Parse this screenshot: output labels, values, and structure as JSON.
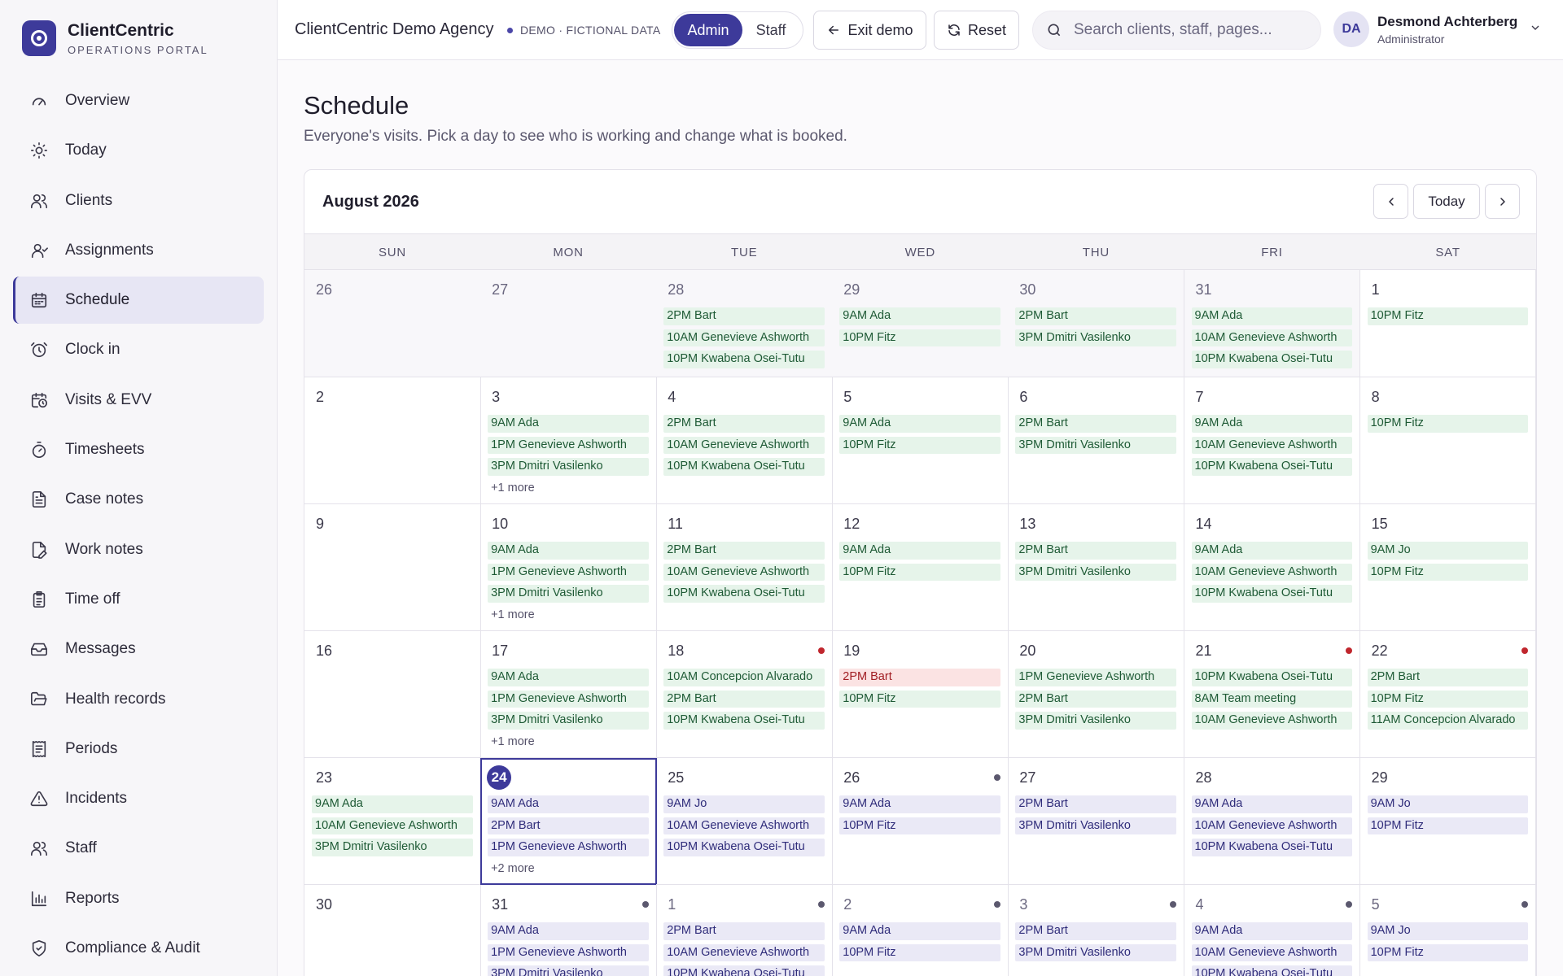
{
  "brand": {
    "name": "ClientCentric",
    "subtitle": "OPERATIONS PORTAL"
  },
  "sidebar": {
    "items": [
      {
        "label": "Overview",
        "icon": "gauge-icon",
        "active": false
      },
      {
        "label": "Today",
        "icon": "sun-icon",
        "active": false
      },
      {
        "label": "Clients",
        "icon": "users-icon",
        "active": false
      },
      {
        "label": "Assignments",
        "icon": "user-check-icon",
        "active": false
      },
      {
        "label": "Schedule",
        "icon": "calendar-icon",
        "active": true
      },
      {
        "label": "Clock in",
        "icon": "alarm-clock-icon",
        "active": false
      },
      {
        "label": "Visits & EVV",
        "icon": "calendar-clock-icon",
        "active": false
      },
      {
        "label": "Timesheets",
        "icon": "stopwatch-icon",
        "active": false
      },
      {
        "label": "Case notes",
        "icon": "file-text-icon",
        "active": false
      },
      {
        "label": "Work notes",
        "icon": "file-edit-icon",
        "active": false
      },
      {
        "label": "Time off",
        "icon": "clipboard-icon",
        "active": false
      },
      {
        "label": "Messages",
        "icon": "inbox-icon",
        "active": false
      },
      {
        "label": "Health records",
        "icon": "folder-open-icon",
        "active": false
      },
      {
        "label": "Periods",
        "icon": "receipt-icon",
        "active": false
      },
      {
        "label": "Incidents",
        "icon": "alert-triangle-icon",
        "active": false
      },
      {
        "label": "Staff",
        "icon": "users-icon",
        "active": false
      },
      {
        "label": "Reports",
        "icon": "bar-chart-icon",
        "active": false
      },
      {
        "label": "Compliance & Audit",
        "icon": "shield-check-icon",
        "active": false
      }
    ]
  },
  "topbar": {
    "agency": "ClientCentric Demo Agency",
    "demo_tag": "DEMO · FICTIONAL DATA",
    "role_admin": "Admin",
    "role_staff": "Staff",
    "exit_label": "Exit demo",
    "reset_label": "Reset",
    "search_placeholder": "Search clients, staff, pages...",
    "user_initials": "DA",
    "user_name": "Desmond Achterberg",
    "user_role": "Administrator"
  },
  "page": {
    "title": "Schedule",
    "subtitle": "Everyone's visits. Pick a day to see who is working and change what is booked."
  },
  "calendar": {
    "month": "August 2026",
    "today_label": "Today",
    "weekdays": [
      "SUN",
      "MON",
      "TUE",
      "WED",
      "THU",
      "FRI",
      "SAT"
    ],
    "weeks": [
      [
        {
          "day": "26",
          "prev": true,
          "events": []
        },
        {
          "day": "27",
          "prev": true,
          "events": []
        },
        {
          "day": "28",
          "prev": true,
          "events": [
            {
              "t": "2PM Bart",
              "c": "green"
            },
            {
              "t": "10AM Genevieve Ashworth",
              "c": "green"
            },
            {
              "t": "10PM Kwabena Osei-Tutu",
              "c": "green"
            }
          ]
        },
        {
          "day": "29",
          "prev": true,
          "events": [
            {
              "t": "9AM Ada",
              "c": "green"
            },
            {
              "t": "10PM Fitz",
              "c": "green"
            }
          ]
        },
        {
          "day": "30",
          "prev": true,
          "events": [
            {
              "t": "2PM Bart",
              "c": "green"
            },
            {
              "t": "3PM Dmitri Vasilenko",
              "c": "green"
            }
          ]
        },
        {
          "day": "31",
          "prev": true,
          "events": [
            {
              "t": "9AM Ada",
              "c": "green"
            },
            {
              "t": "10AM Genevieve Ashworth",
              "c": "green"
            },
            {
              "t": "10PM Kwabena Osei-Tutu",
              "c": "green"
            }
          ]
        },
        {
          "day": "1",
          "events": [
            {
              "t": "10PM Fitz",
              "c": "green"
            }
          ]
        }
      ],
      [
        {
          "day": "2",
          "events": []
        },
        {
          "day": "3",
          "events": [
            {
              "t": "9AM Ada",
              "c": "green"
            },
            {
              "t": "1PM Genevieve Ashworth",
              "c": "green"
            },
            {
              "t": "3PM Dmitri Vasilenko",
              "c": "green"
            }
          ],
          "more": "+1 more"
        },
        {
          "day": "4",
          "events": [
            {
              "t": "2PM Bart",
              "c": "green"
            },
            {
              "t": "10AM Genevieve Ashworth",
              "c": "green"
            },
            {
              "t": "10PM Kwabena Osei-Tutu",
              "c": "green"
            }
          ]
        },
        {
          "day": "5",
          "events": [
            {
              "t": "9AM Ada",
              "c": "green"
            },
            {
              "t": "10PM Fitz",
              "c": "green"
            }
          ]
        },
        {
          "day": "6",
          "events": [
            {
              "t": "2PM Bart",
              "c": "green"
            },
            {
              "t": "3PM Dmitri Vasilenko",
              "c": "green"
            }
          ]
        },
        {
          "day": "7",
          "events": [
            {
              "t": "9AM Ada",
              "c": "green"
            },
            {
              "t": "10AM Genevieve Ashworth",
              "c": "green"
            },
            {
              "t": "10PM Kwabena Osei-Tutu",
              "c": "green"
            }
          ]
        },
        {
          "day": "8",
          "events": [
            {
              "t": "10PM Fitz",
              "c": "green"
            }
          ]
        }
      ],
      [
        {
          "day": "9",
          "events": []
        },
        {
          "day": "10",
          "events": [
            {
              "t": "9AM Ada",
              "c": "green"
            },
            {
              "t": "1PM Genevieve Ashworth",
              "c": "green"
            },
            {
              "t": "3PM Dmitri Vasilenko",
              "c": "green"
            }
          ],
          "more": "+1 more"
        },
        {
          "day": "11",
          "events": [
            {
              "t": "2PM Bart",
              "c": "green"
            },
            {
              "t": "10AM Genevieve Ashworth",
              "c": "green"
            },
            {
              "t": "10PM Kwabena Osei-Tutu",
              "c": "green"
            }
          ]
        },
        {
          "day": "12",
          "events": [
            {
              "t": "9AM Ada",
              "c": "green"
            },
            {
              "t": "10PM Fitz",
              "c": "green"
            }
          ]
        },
        {
          "day": "13",
          "events": [
            {
              "t": "2PM Bart",
              "c": "green"
            },
            {
              "t": "3PM Dmitri Vasilenko",
              "c": "green"
            }
          ]
        },
        {
          "day": "14",
          "events": [
            {
              "t": "9AM Ada",
              "c": "green"
            },
            {
              "t": "10AM Genevieve Ashworth",
              "c": "green"
            },
            {
              "t": "10PM Kwabena Osei-Tutu",
              "c": "green"
            }
          ]
        },
        {
          "day": "15",
          "events": [
            {
              "t": "9AM Jo",
              "c": "green"
            },
            {
              "t": "10PM Fitz",
              "c": "green"
            }
          ]
        }
      ],
      [
        {
          "day": "16",
          "events": []
        },
        {
          "day": "17",
          "events": [
            {
              "t": "9AM Ada",
              "c": "green"
            },
            {
              "t": "1PM Genevieve Ashworth",
              "c": "green"
            },
            {
              "t": "3PM Dmitri Vasilenko",
              "c": "green"
            }
          ],
          "more": "+1 more"
        },
        {
          "day": "18",
          "dot": "red",
          "events": [
            {
              "t": "10AM Concepcion Alvarado",
              "c": "green"
            },
            {
              "t": "2PM Bart",
              "c": "green"
            },
            {
              "t": "10PM Kwabena Osei-Tutu",
              "c": "green"
            }
          ]
        },
        {
          "day": "19",
          "events": [
            {
              "t": "2PM Bart",
              "c": "red"
            },
            {
              "t": "10PM Fitz",
              "c": "green"
            }
          ]
        },
        {
          "day": "20",
          "events": [
            {
              "t": "1PM Genevieve Ashworth",
              "c": "green"
            },
            {
              "t": "2PM Bart",
              "c": "green"
            },
            {
              "t": "3PM Dmitri Vasilenko",
              "c": "green"
            }
          ]
        },
        {
          "day": "21",
          "dot": "red",
          "events": [
            {
              "t": "10PM Kwabena Osei-Tutu",
              "c": "green"
            },
            {
              "t": "8AM Team meeting",
              "c": "green"
            },
            {
              "t": "10AM Genevieve Ashworth",
              "c": "green"
            }
          ]
        },
        {
          "day": "22",
          "dot": "red",
          "events": [
            {
              "t": "2PM Bart",
              "c": "green"
            },
            {
              "t": "10PM Fitz",
              "c": "green"
            },
            {
              "t": "11AM Concepcion Alvarado",
              "c": "green"
            }
          ]
        }
      ],
      [
        {
          "day": "23",
          "events": [
            {
              "t": "9AM Ada",
              "c": "green"
            },
            {
              "t": "10AM Genevieve Ashworth",
              "c": "green"
            },
            {
              "t": "3PM Dmitri Vasilenko",
              "c": "green"
            }
          ]
        },
        {
          "day": "24",
          "today": true,
          "events": [
            {
              "t": "9AM Ada",
              "c": "purple"
            },
            {
              "t": "2PM Bart",
              "c": "purple"
            },
            {
              "t": "1PM Genevieve Ashworth",
              "c": "purple"
            }
          ],
          "more": "+2 more"
        },
        {
          "day": "25",
          "events": [
            {
              "t": "9AM Jo",
              "c": "purple"
            },
            {
              "t": "10AM Genevieve Ashworth",
              "c": "purple"
            },
            {
              "t": "10PM Kwabena Osei-Tutu",
              "c": "purple"
            }
          ]
        },
        {
          "day": "26",
          "dot": "gray",
          "events": [
            {
              "t": "9AM Ada",
              "c": "purple"
            },
            {
              "t": "10PM Fitz",
              "c": "purple"
            }
          ]
        },
        {
          "day": "27",
          "events": [
            {
              "t": "2PM Bart",
              "c": "purple"
            },
            {
              "t": "3PM Dmitri Vasilenko",
              "c": "purple"
            }
          ]
        },
        {
          "day": "28",
          "events": [
            {
              "t": "9AM Ada",
              "c": "purple"
            },
            {
              "t": "10AM Genevieve Ashworth",
              "c": "purple"
            },
            {
              "t": "10PM Kwabena Osei-Tutu",
              "c": "purple"
            }
          ]
        },
        {
          "day": "29",
          "events": [
            {
              "t": "9AM Jo",
              "c": "purple"
            },
            {
              "t": "10PM Fitz",
              "c": "purple"
            }
          ]
        }
      ],
      [
        {
          "day": "30",
          "events": []
        },
        {
          "day": "31",
          "dot": "gray",
          "events": [
            {
              "t": "9AM Ada",
              "c": "purple"
            },
            {
              "t": "1PM Genevieve Ashworth",
              "c": "purple"
            },
            {
              "t": "3PM Dmitri Vasilenko",
              "c": "purple"
            }
          ]
        },
        {
          "day": "1",
          "next": true,
          "dot": "gray",
          "events": [
            {
              "t": "2PM Bart",
              "c": "purple"
            },
            {
              "t": "10AM Genevieve Ashworth",
              "c": "purple"
            },
            {
              "t": "10PM Kwabena Osei-Tutu",
              "c": "purple"
            }
          ]
        },
        {
          "day": "2",
          "next": true,
          "dot": "gray",
          "events": [
            {
              "t": "9AM Ada",
              "c": "purple"
            },
            {
              "t": "10PM Fitz",
              "c": "purple"
            }
          ]
        },
        {
          "day": "3",
          "next": true,
          "dot": "gray",
          "events": [
            {
              "t": "2PM Bart",
              "c": "purple"
            },
            {
              "t": "3PM Dmitri Vasilenko",
              "c": "purple"
            }
          ]
        },
        {
          "day": "4",
          "next": true,
          "dot": "gray",
          "events": [
            {
              "t": "9AM Ada",
              "c": "purple"
            },
            {
              "t": "10AM Genevieve Ashworth",
              "c": "purple"
            },
            {
              "t": "10PM Kwabena Osei-Tutu",
              "c": "purple"
            }
          ]
        },
        {
          "day": "5",
          "next": true,
          "dot": "gray",
          "events": [
            {
              "t": "9AM Jo",
              "c": "purple"
            },
            {
              "t": "10PM Fitz",
              "c": "purple"
            }
          ]
        }
      ]
    ]
  }
}
